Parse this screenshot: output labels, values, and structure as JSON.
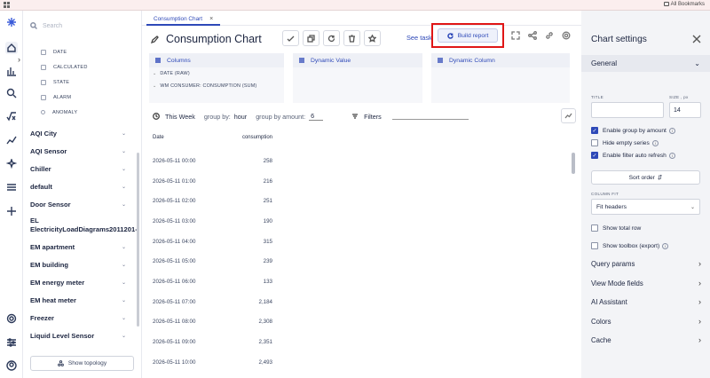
{
  "bookmarks": {
    "label": "All Bookmarks"
  },
  "sidebar": {
    "search_placeholder": "Search",
    "fields": [
      {
        "label": "DATE",
        "icon": "calendar-icon"
      },
      {
        "label": "CALCULATED",
        "icon": "calculator-icon"
      },
      {
        "label": "STATE",
        "icon": "state-icon"
      },
      {
        "label": "ALARM",
        "icon": "alarm-icon"
      },
      {
        "label": "ANOMALY",
        "icon": "magnifier-icon"
      }
    ],
    "groups": [
      "AQI City",
      "AQI Sensor",
      "Chiller",
      "default",
      "Door Sensor",
      "EL ElectricityLoadDiagrams2011201-",
      "EM apartment",
      "EM building",
      "EM energy meter",
      "EM heat meter",
      "Freezer",
      "Liquid Level Sensor"
    ],
    "topology_button": "Show topology"
  },
  "tabs": [
    {
      "label": "Consumption Chart"
    }
  ],
  "header": {
    "title": "Consumption Chart",
    "see_task": "See task",
    "build_report": "Build report"
  },
  "pivot": {
    "columns_label": "Columns",
    "columns_items": [
      "DATE (RAW)",
      "WM CONSUMER: CONSUMPTION (SUM)"
    ],
    "dynamic_value_label": "Dynamic Value",
    "dynamic_column_label": "Dynamic Column"
  },
  "filter_bar": {
    "period": "This Week",
    "group_by_label": "group by:",
    "group_by_value": "hour",
    "group_amount_label": "group by amount:",
    "group_amount_value": "6",
    "filters_label": "Filters"
  },
  "table": {
    "columns": [
      "Date",
      "consumption"
    ],
    "rows": [
      [
        "2026-05-11 00:00",
        "258"
      ],
      [
        "2026-05-11 01:00",
        "216"
      ],
      [
        "2026-05-11 02:00",
        "251"
      ],
      [
        "2026-05-11 03:00",
        "190"
      ],
      [
        "2026-05-11 04:00",
        "315"
      ],
      [
        "2026-05-11 05:00",
        "239"
      ],
      [
        "2026-05-11 06:00",
        "133"
      ],
      [
        "2026-05-11 07:00",
        "2,184"
      ],
      [
        "2026-05-11 08:00",
        "2,308"
      ],
      [
        "2026-05-11 09:00",
        "2,351"
      ],
      [
        "2026-05-11 10:00",
        "2,493"
      ]
    ]
  },
  "settings": {
    "title": "Chart settings",
    "section": "General",
    "title_label": "TITLE",
    "title_value": "",
    "size_label": "SIZE , px",
    "size_value": "14",
    "enable_group_by_amount": {
      "label": "Enable group by amount",
      "checked": true
    },
    "hide_empty_series": {
      "label": "Hide empty series",
      "checked": false
    },
    "enable_filter_auto_refresh": {
      "label": "Enable filter auto refresh",
      "checked": true
    },
    "sort_order": "Sort order",
    "column_fit_label": "COLUMN FIT",
    "column_fit_value": "Fit headers",
    "show_total_row": {
      "label": "Show total row",
      "checked": false
    },
    "show_toolbox": {
      "label": "Show toolbox (export)",
      "checked": false
    },
    "sections": [
      "Query params",
      "View Mode fields",
      "AI Assistant",
      "Colors",
      "Cache"
    ]
  },
  "colors": {
    "accent": "#2e49b8",
    "highlight": "#e01616"
  }
}
